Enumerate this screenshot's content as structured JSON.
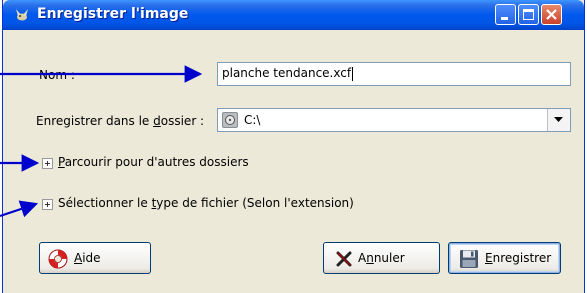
{
  "window": {
    "title": "Enregistrer l'image"
  },
  "form": {
    "name_label": "Nom :",
    "name_value": "planche tendance.xcf",
    "folder_label_prefix": "Enregistrer dans le ",
    "folder_label_u": "d",
    "folder_label_suffix": "ossier :",
    "folder_value": "C:\\",
    "browse_u": "P",
    "browse_rest": "arcourir pour d'autres dossiers",
    "filetype_prefix": "Sélectionner le ",
    "filetype_u": "t",
    "filetype_suffix": "ype de fichier (Selon l'extension)"
  },
  "buttons": {
    "help_u": "A",
    "help_rest": "ide",
    "cancel_prefix": "A",
    "cancel_u": "n",
    "cancel_suffix": "nuler",
    "save_u": "E",
    "save_rest": "nregistrer"
  },
  "colors": {
    "annotation_arrow": "#0000cc"
  },
  "icons": {
    "title": "gimp-wilber-icon",
    "drive": "hard-drive-icon",
    "help": "lifebuoy-icon",
    "cancel": "x-icon",
    "save": "floppy-disk-icon"
  }
}
